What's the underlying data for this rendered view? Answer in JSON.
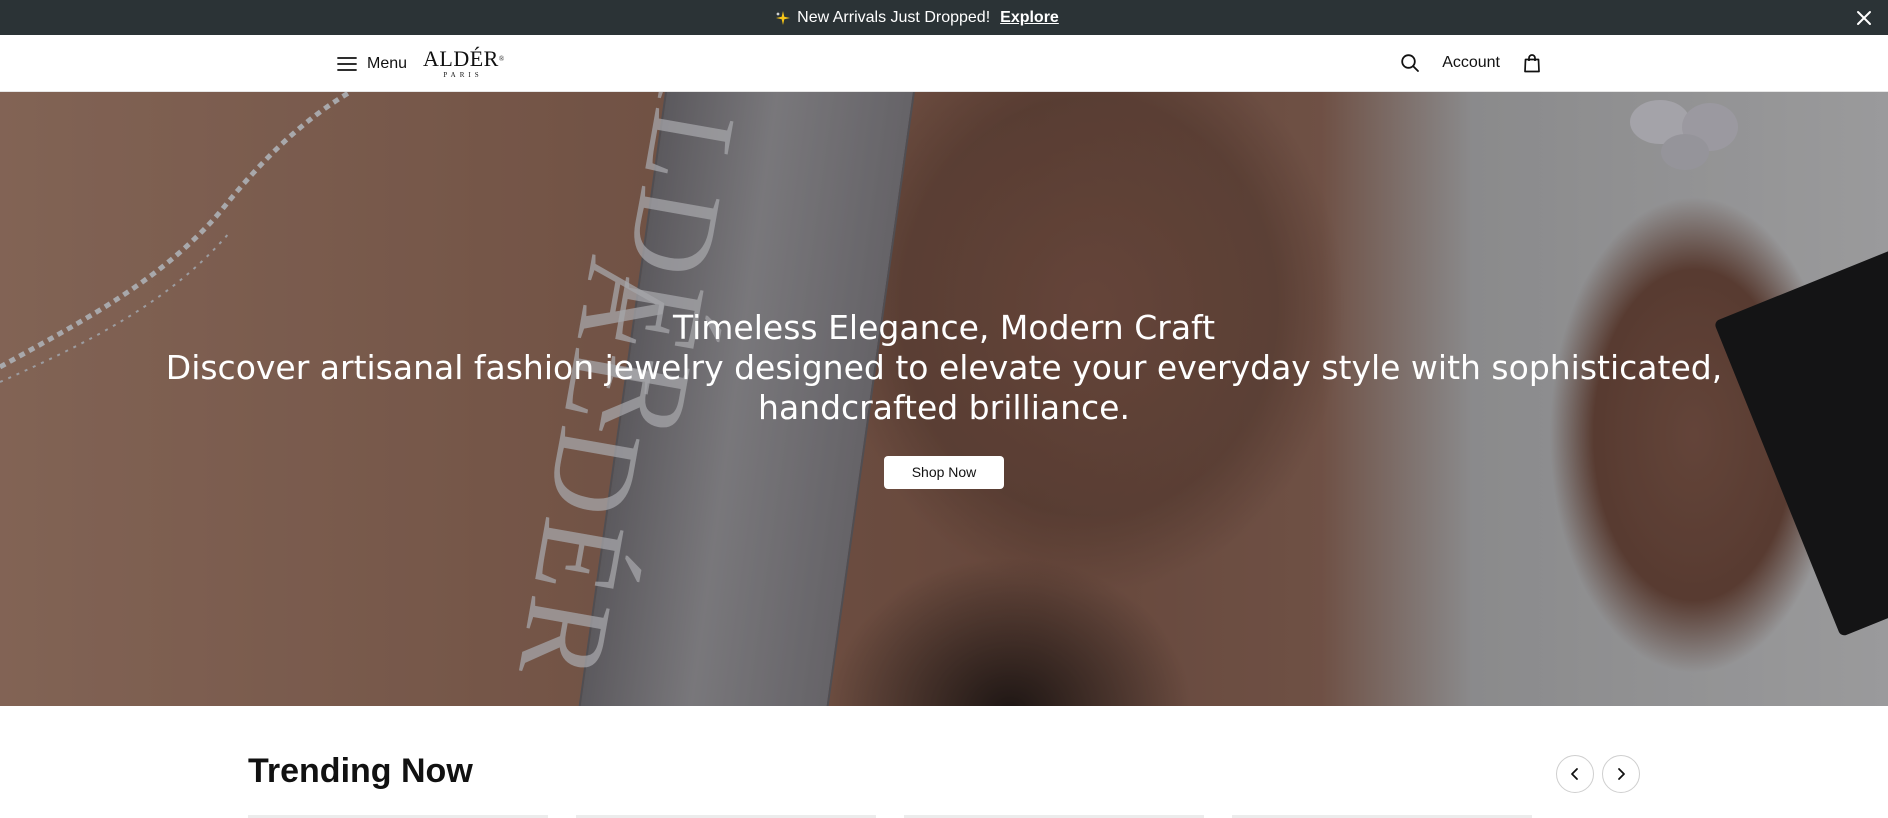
{
  "announcement": {
    "message": "New Arrivals Just Dropped!",
    "link_label": "Explore"
  },
  "header": {
    "menu_label": "Menu",
    "logo_brand": "ALDÉR",
    "logo_sub": "PARIS",
    "account_label": "Account"
  },
  "hero": {
    "title": "Timeless Elegance, Modern Craft",
    "subtitle": "Discover artisanal fashion jewelry designed to elevate your everyday style with sophisticated, handcrafted brilliance.",
    "cta_label": "Shop Now",
    "ribbon_text": "ALDÉR"
  },
  "trending": {
    "title": "Trending Now"
  },
  "icons": {
    "sparkle": "sparkle-icon",
    "close": "close-icon",
    "menu": "hamburger-icon",
    "search": "search-icon",
    "bag": "shopping-bag-icon",
    "prev": "chevron-left-icon",
    "next": "chevron-right-icon"
  },
  "colors": {
    "announcement_bg": "#2b3336",
    "cta_bg": "#ffffff",
    "text": "#111111"
  }
}
